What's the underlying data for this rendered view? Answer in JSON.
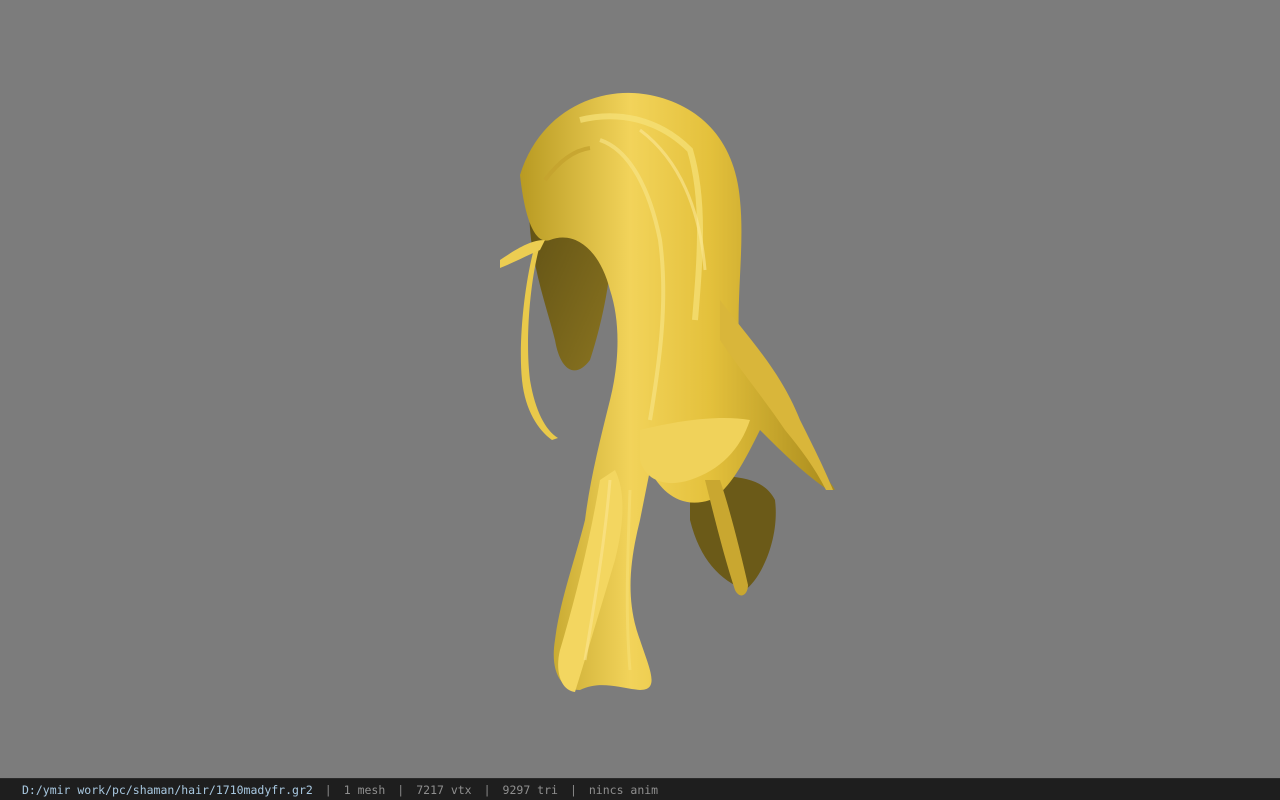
{
  "viewport": {
    "background_color": "#7c7c7c",
    "model_icon": "hair-mesh-icon",
    "model_color": "#e7c340"
  },
  "status": {
    "file_path": "D:/ymir work/pc/shaman/hair/1710madyfr.gr2",
    "mesh_count": "1 mesh",
    "vertex_count": "7217 vtx",
    "triangle_count": "9297 tri",
    "anim_status": "nincs anim",
    "separator": "|"
  }
}
